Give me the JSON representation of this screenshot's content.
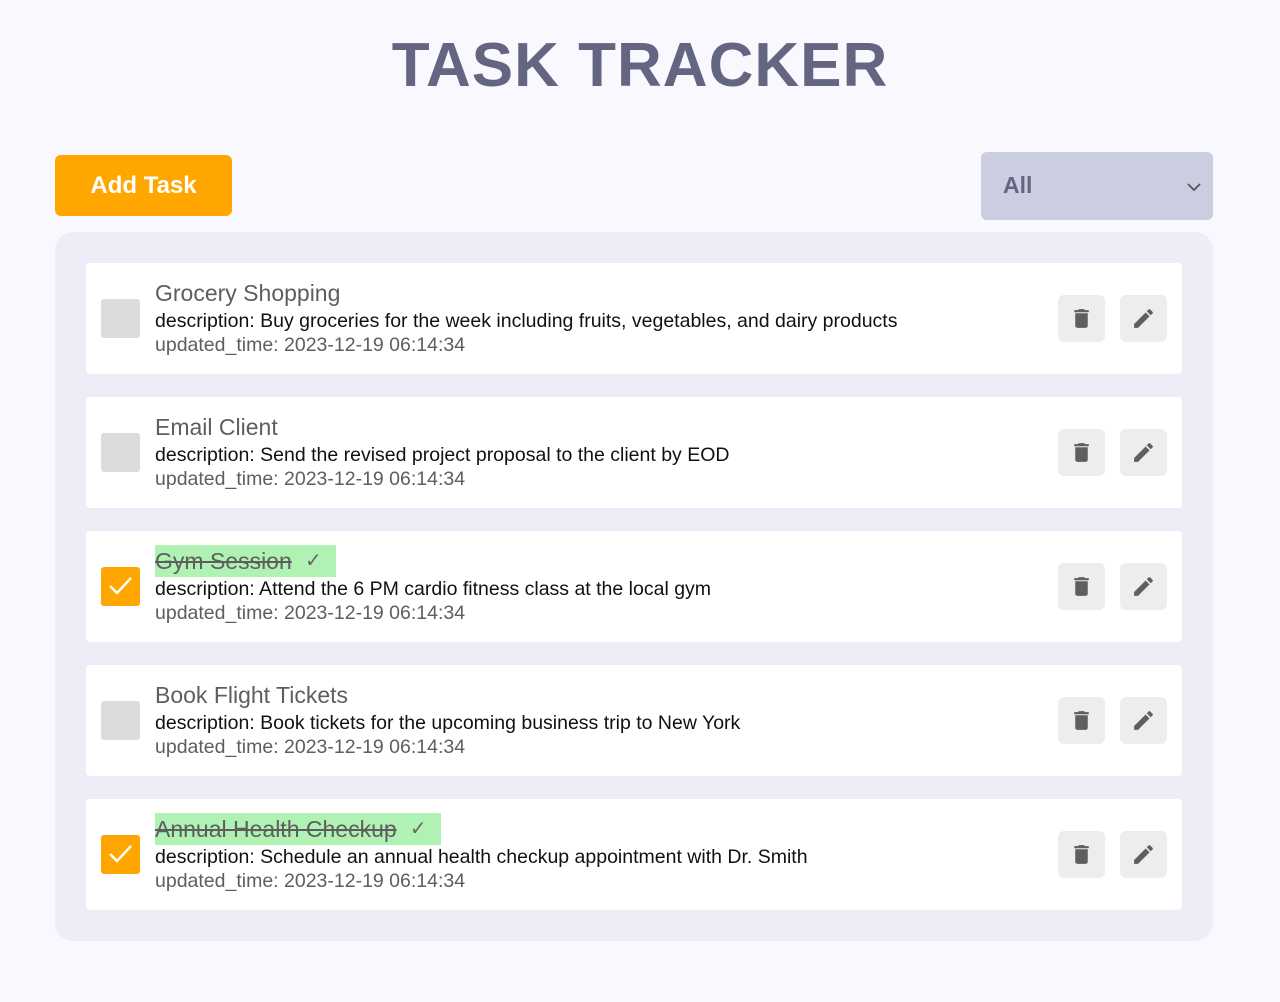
{
  "header": {
    "title": "TASK TRACKER"
  },
  "toolbar": {
    "add_label": "Add Task",
    "filter_value": "All"
  },
  "colors": {
    "accent": "#ffa600",
    "title": "#646681",
    "completed_highlight": "#b0f2b4"
  },
  "icons": {
    "delete": "trash-icon",
    "edit": "pencil-icon",
    "checkbox": "check-icon",
    "dropdown": "chevron-down-icon"
  },
  "tasks": [
    {
      "title": "Grocery Shopping",
      "description": "description: Buy groceries for the week including fruits, vegetables, and dairy products",
      "updated": "updated_time: 2023-12-19 06:14:34",
      "completed": false
    },
    {
      "title": "Email Client",
      "description": "description: Send the revised project proposal to the client by EOD",
      "updated": "updated_time: 2023-12-19 06:14:34",
      "completed": false
    },
    {
      "title": "Gym Session",
      "description": "description: Attend the 6 PM cardio fitness class at the local gym",
      "updated": "updated_time: 2023-12-19 06:14:34",
      "completed": true,
      "done_mark": "✓"
    },
    {
      "title": "Book Flight Tickets",
      "description": "description: Book tickets for the upcoming business trip to New York",
      "updated": "updated_time: 2023-12-19 06:14:34",
      "completed": false
    },
    {
      "title": "Annual Health Checkup",
      "description": "description: Schedule an annual health checkup appointment with Dr. Smith",
      "updated": "updated_time: 2023-12-19 06:14:34",
      "completed": true,
      "done_mark": "✓"
    }
  ]
}
